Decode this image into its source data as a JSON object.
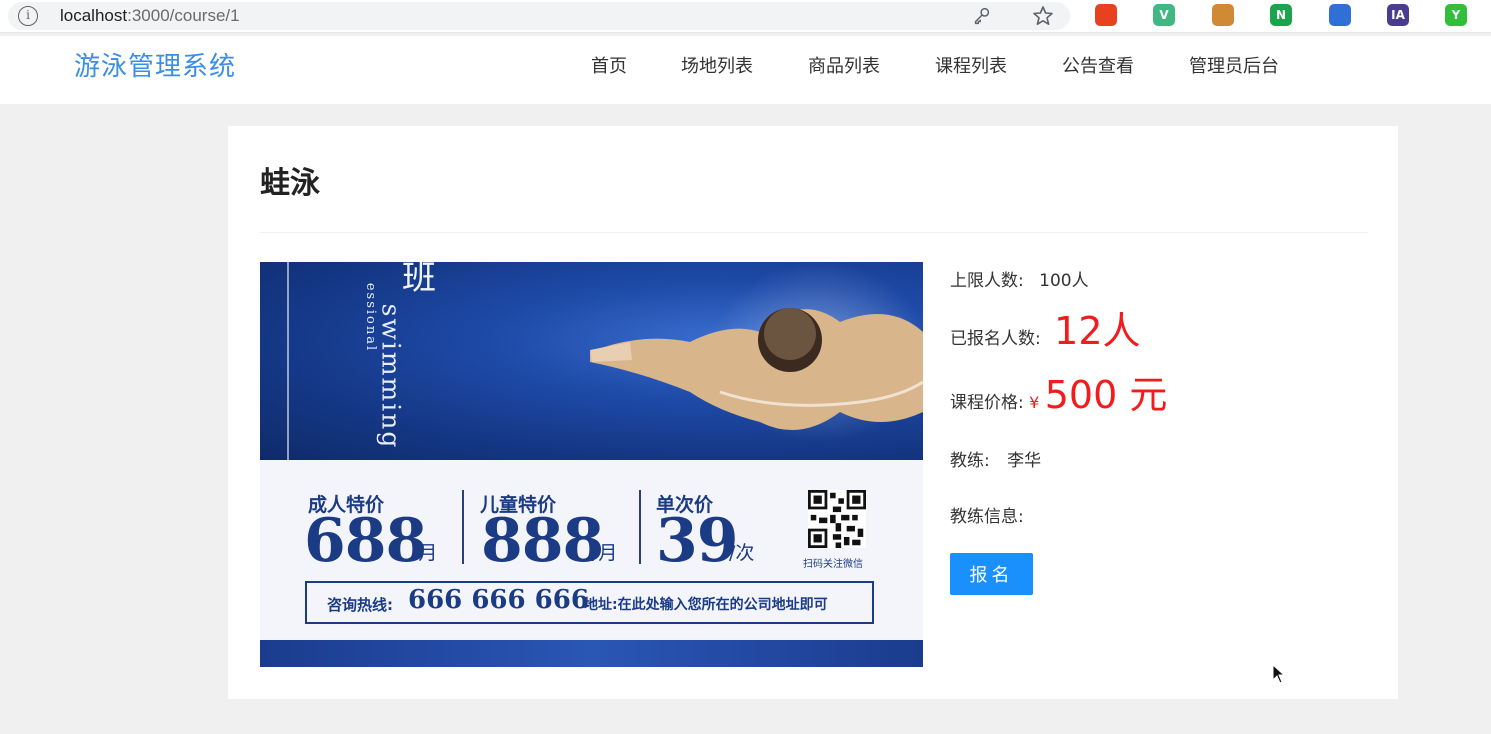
{
  "browser": {
    "url_host": "localhost",
    "url_path": ":3000/course/1",
    "extensions": [
      {
        "name": "ext-red-icon",
        "color": "#e8411f",
        "text": ""
      },
      {
        "name": "vue-devtools-icon",
        "color": "#41b883",
        "text": "V"
      },
      {
        "name": "cookie-icon",
        "color": "#d08a36",
        "text": ""
      },
      {
        "name": "n-extension-icon",
        "color": "#1aa44b",
        "text": "N"
      },
      {
        "name": "blue-circle-extension-icon",
        "color": "#2f6fd6",
        "text": ""
      },
      {
        "name": "ia-extension-icon",
        "color": "#4a3d8f",
        "text": "IA"
      },
      {
        "name": "green-check-extension-icon",
        "color": "#2fbf3b",
        "text": "Y"
      }
    ]
  },
  "header": {
    "brand": "游泳管理系统",
    "nav": [
      "首页",
      "场地列表",
      "商品列表",
      "课程列表",
      "公告查看",
      "管理员后台"
    ]
  },
  "course": {
    "title": "蛙泳",
    "limit_label": "上限人数:",
    "limit_value": "100人",
    "enrolled_label": "已报名人数:",
    "enrolled_value": "12人",
    "price_label": "课程价格:",
    "price_currency": "¥",
    "price_value": "500 元",
    "coach_label": "教练:",
    "coach_value": "李华",
    "coach_info_label": "教练信息:",
    "enroll_button": "报名"
  },
  "poster": {
    "corner_text": "班",
    "vertical_text": "swimming",
    "vertical_sub": "essional",
    "adult_label": "成人特价",
    "adult_price": "688",
    "adult_unit": "/月",
    "child_label": "儿童特价",
    "child_price": "888",
    "child_unit": "/月",
    "single_label": "单次价",
    "single_price": "39",
    "single_unit": "/次",
    "qr_caption": "扫码关注微信",
    "hotline_label": "咨询热线:",
    "hotline_number": "666 666 666",
    "address_text": "地址:在此处输入您所在的公司地址即可"
  },
  "colors": {
    "brand": "#3a8ee6",
    "accent_red": "#f31b1b",
    "button": "#1990fb",
    "poster_navy": "#1c3b85"
  }
}
